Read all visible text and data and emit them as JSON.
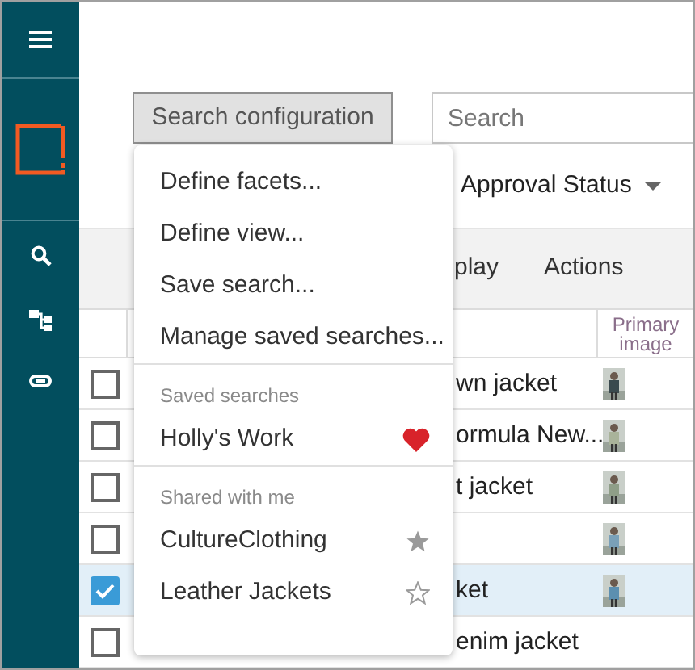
{
  "toolbar": {
    "config_button": "Search configuration",
    "search": {
      "placeholder": "Search"
    }
  },
  "filter": {
    "label": "Approval Status"
  },
  "band": {
    "tabs": [
      "play",
      "Actions"
    ]
  },
  "table": {
    "columns": {
      "column_3": "Primary image"
    },
    "rows": [
      {
        "checked": false,
        "selected": false,
        "text": "wn jacket",
        "image": true
      },
      {
        "checked": false,
        "selected": false,
        "text": "ormula New...",
        "image": true
      },
      {
        "checked": false,
        "selected": false,
        "text": "t jacket",
        "image": true
      },
      {
        "checked": false,
        "selected": false,
        "image": true
      },
      {
        "checked": true,
        "selected": true,
        "text": "ket",
        "image": true
      },
      {
        "checked": false,
        "selected": false,
        "text": "enim jacket",
        "image": false
      }
    ]
  },
  "menu": {
    "actions": [
      "Define facets...",
      "Define view...",
      "Save search...",
      "Manage saved searches..."
    ],
    "sections": [
      {
        "heading": "Saved searches",
        "items": [
          {
            "label": "Holly's Work",
            "kind": "heart"
          }
        ]
      },
      {
        "heading": "Shared with me",
        "items": [
          {
            "label": "CultureClothing",
            "kind": "star",
            "starred": true
          },
          {
            "label": "Leather Jackets",
            "kind": "star",
            "starred": false
          }
        ]
      }
    ]
  }
}
